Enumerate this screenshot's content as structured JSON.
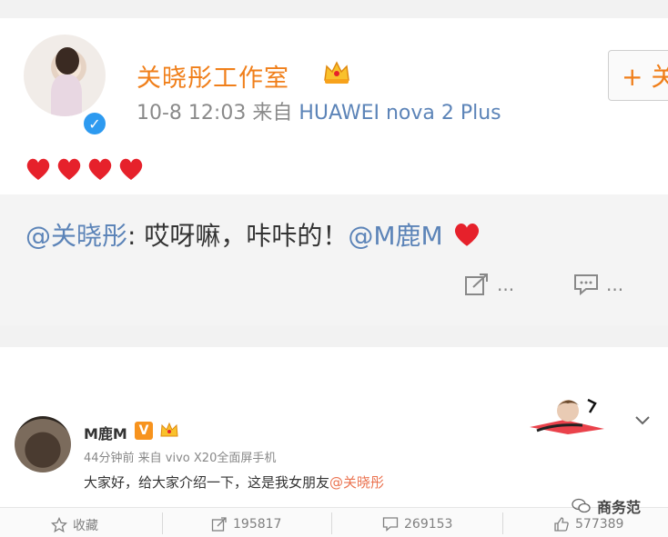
{
  "post": {
    "author": "关晓彤工作室",
    "time": "10-8 12:03",
    "via": "来自",
    "device": "HUAWEI nova 2 Plus",
    "follow_label": "+ 关",
    "body_icons": [
      "heart-icon",
      "heart-icon",
      "heart-icon",
      "heart-icon"
    ],
    "repost": {
      "mention": "@关晓彤",
      "text": ": 哎呀嘛，咔咔的！",
      "mention2": "@M鹿M"
    },
    "share_label": "...",
    "comment_label": "..."
  },
  "original": {
    "author": "M鹿M",
    "v_badge": "V",
    "meta": "44分钟前 来自 vivo X20全面屏手机",
    "text": "大家好，给大家介绍一下，这是我女朋友",
    "mention": "@关晓彤"
  },
  "footer": {
    "favorite": "收藏",
    "reposts": "195817",
    "comments": "269153",
    "likes": "577389"
  },
  "watermark": "商务范",
  "colors": {
    "accent_orange": "#f07f1a",
    "link_blue": "#5c84b8",
    "heart_red": "#e6212b",
    "verified_blue": "#2d9af0"
  }
}
